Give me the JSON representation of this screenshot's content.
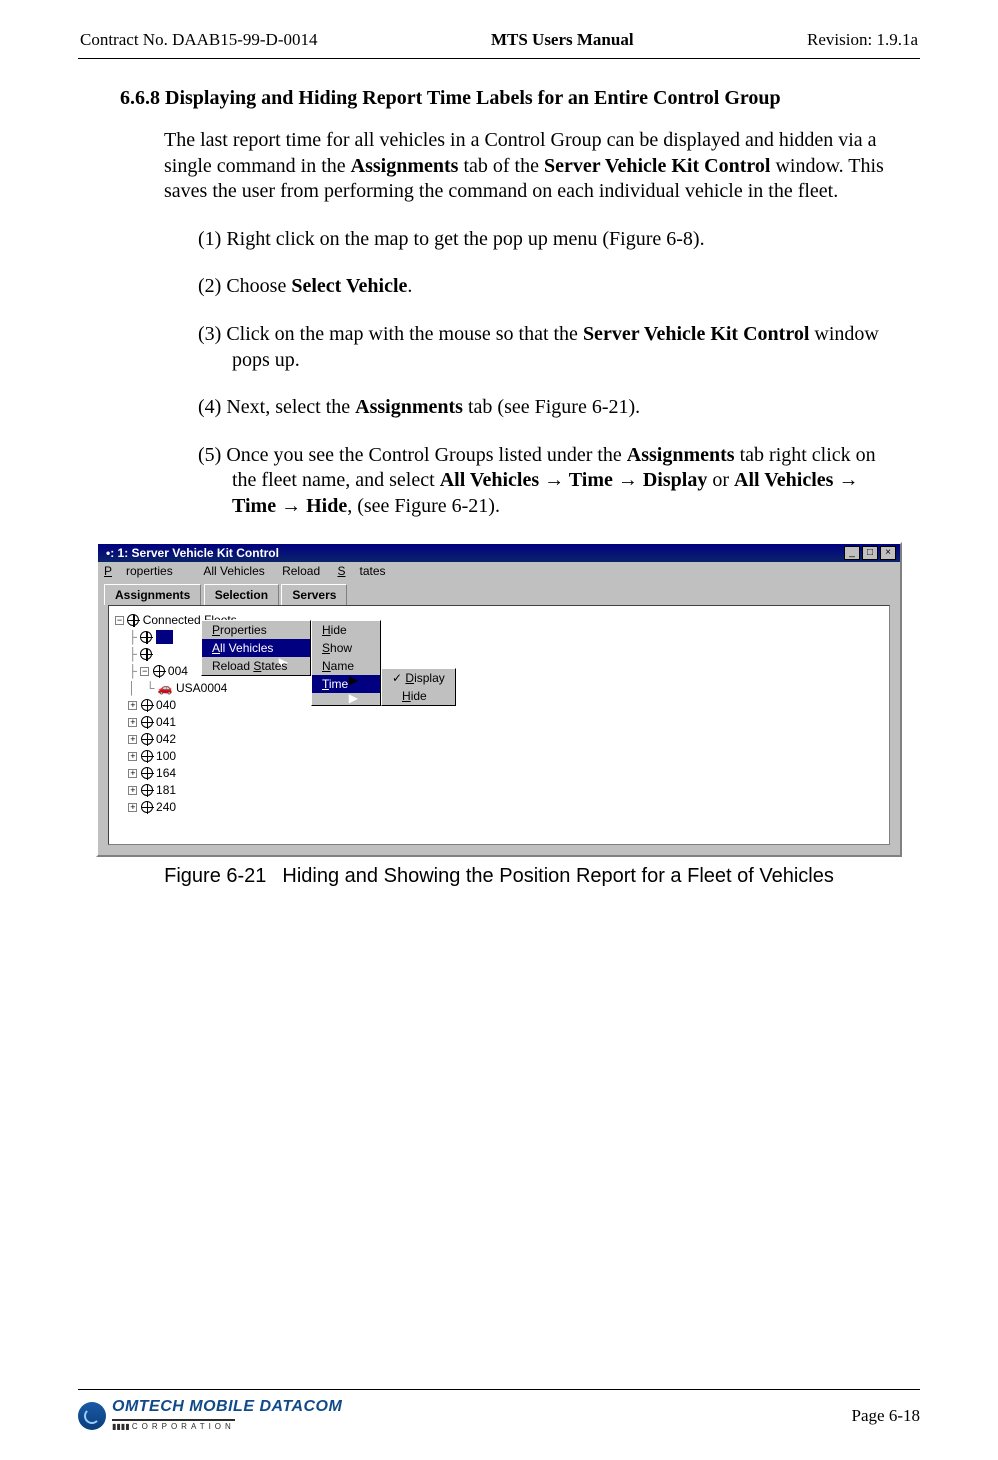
{
  "header": {
    "left": "Contract No. DAAB15-99-D-0014",
    "center": "MTS Users Manual",
    "right": "Revision:  1.9.1a"
  },
  "section_heading": "6.6.8  Displaying and Hiding Report Time Labels for an Entire Control Group",
  "body_para_parts": {
    "p1": "The last report time for all vehicles in a Control Group can be displayed and hidden via a single command in the ",
    "b1": "Assignments",
    "p2": " tab of the ",
    "b2": "Server Vehicle Kit Control",
    "p3": " window.  This saves the user from performing the command on each individual vehicle in the fleet."
  },
  "steps": {
    "s1": "(1) Right click on the map to get the pop up menu (Figure 6-8).",
    "s2_a": "(2) Choose ",
    "s2_b": "Select Vehicle",
    "s2_c": ".",
    "s3_a": "(3) Click on the map with the mouse so that the ",
    "s3_b": "Server Vehicle Kit Control",
    "s3_c": " window pops up.",
    "s4_a": "(4) Next, select the ",
    "s4_b": "Assignments",
    "s4_c": " tab (see Figure 6-21).",
    "s5_a": "(5) Once you see the Control Groups listed under the ",
    "s5_b": "Assignments",
    "s5_c": " tab right click on the fleet name, and select ",
    "s5_d": "All Vehicles ",
    "s5_e": " Time ",
    "s5_f": " Display",
    "s5_g": " or ",
    "s5_h": "All Vehicles ",
    "s5_i": " Time ",
    "s5_j": " Hide",
    "s5_k": ", (see Figure 6-21)."
  },
  "arrow": "→",
  "screenshot": {
    "title": "1: Server Vehicle Kit Control",
    "menubar": {
      "m1_u": "P",
      "m1": "roperties",
      "m2": "All Vehicles",
      "m3": "Reload ",
      "m3_u": "S",
      "m3_b": "tates"
    },
    "tabs": {
      "t1": "Assignments",
      "t2": "Selection",
      "t3": "Servers"
    },
    "winbtns": {
      "min": "_",
      "max": "□",
      "close": "×"
    },
    "tree": {
      "root": "Connected Fleets",
      "n004": "004",
      "usa": "USA0004",
      "n040": "040",
      "n041": "041",
      "n042": "042",
      "n100": "100",
      "n164": "164",
      "n181": "181",
      "n240": "240"
    },
    "ctx1": {
      "i1_u": "P",
      "i1": "roperties",
      "i2_u": "A",
      "i2": "ll Vehicles",
      "i3": "Reload ",
      "i3_u": "S",
      "i3_b": "tates"
    },
    "ctx2": {
      "i1_u": "H",
      "i1": "ide",
      "i2_u": "S",
      "i2": "how",
      "i3_u": "N",
      "i3": "ame",
      "i4_u": "T",
      "i4": "ime"
    },
    "ctx3": {
      "i1_u": "D",
      "i1": "isplay",
      "i2_u": "H",
      "i2": "ide",
      "chk": "✓"
    }
  },
  "figure": {
    "label": "Figure 6-21",
    "caption": "Hiding and Showing the Position Report for a Fleet of Vehicles"
  },
  "footer": {
    "logo_top": "OMTECH MOBILE DATACOM",
    "logo_bot": "CORPORATION",
    "page": "Page 6-18"
  }
}
